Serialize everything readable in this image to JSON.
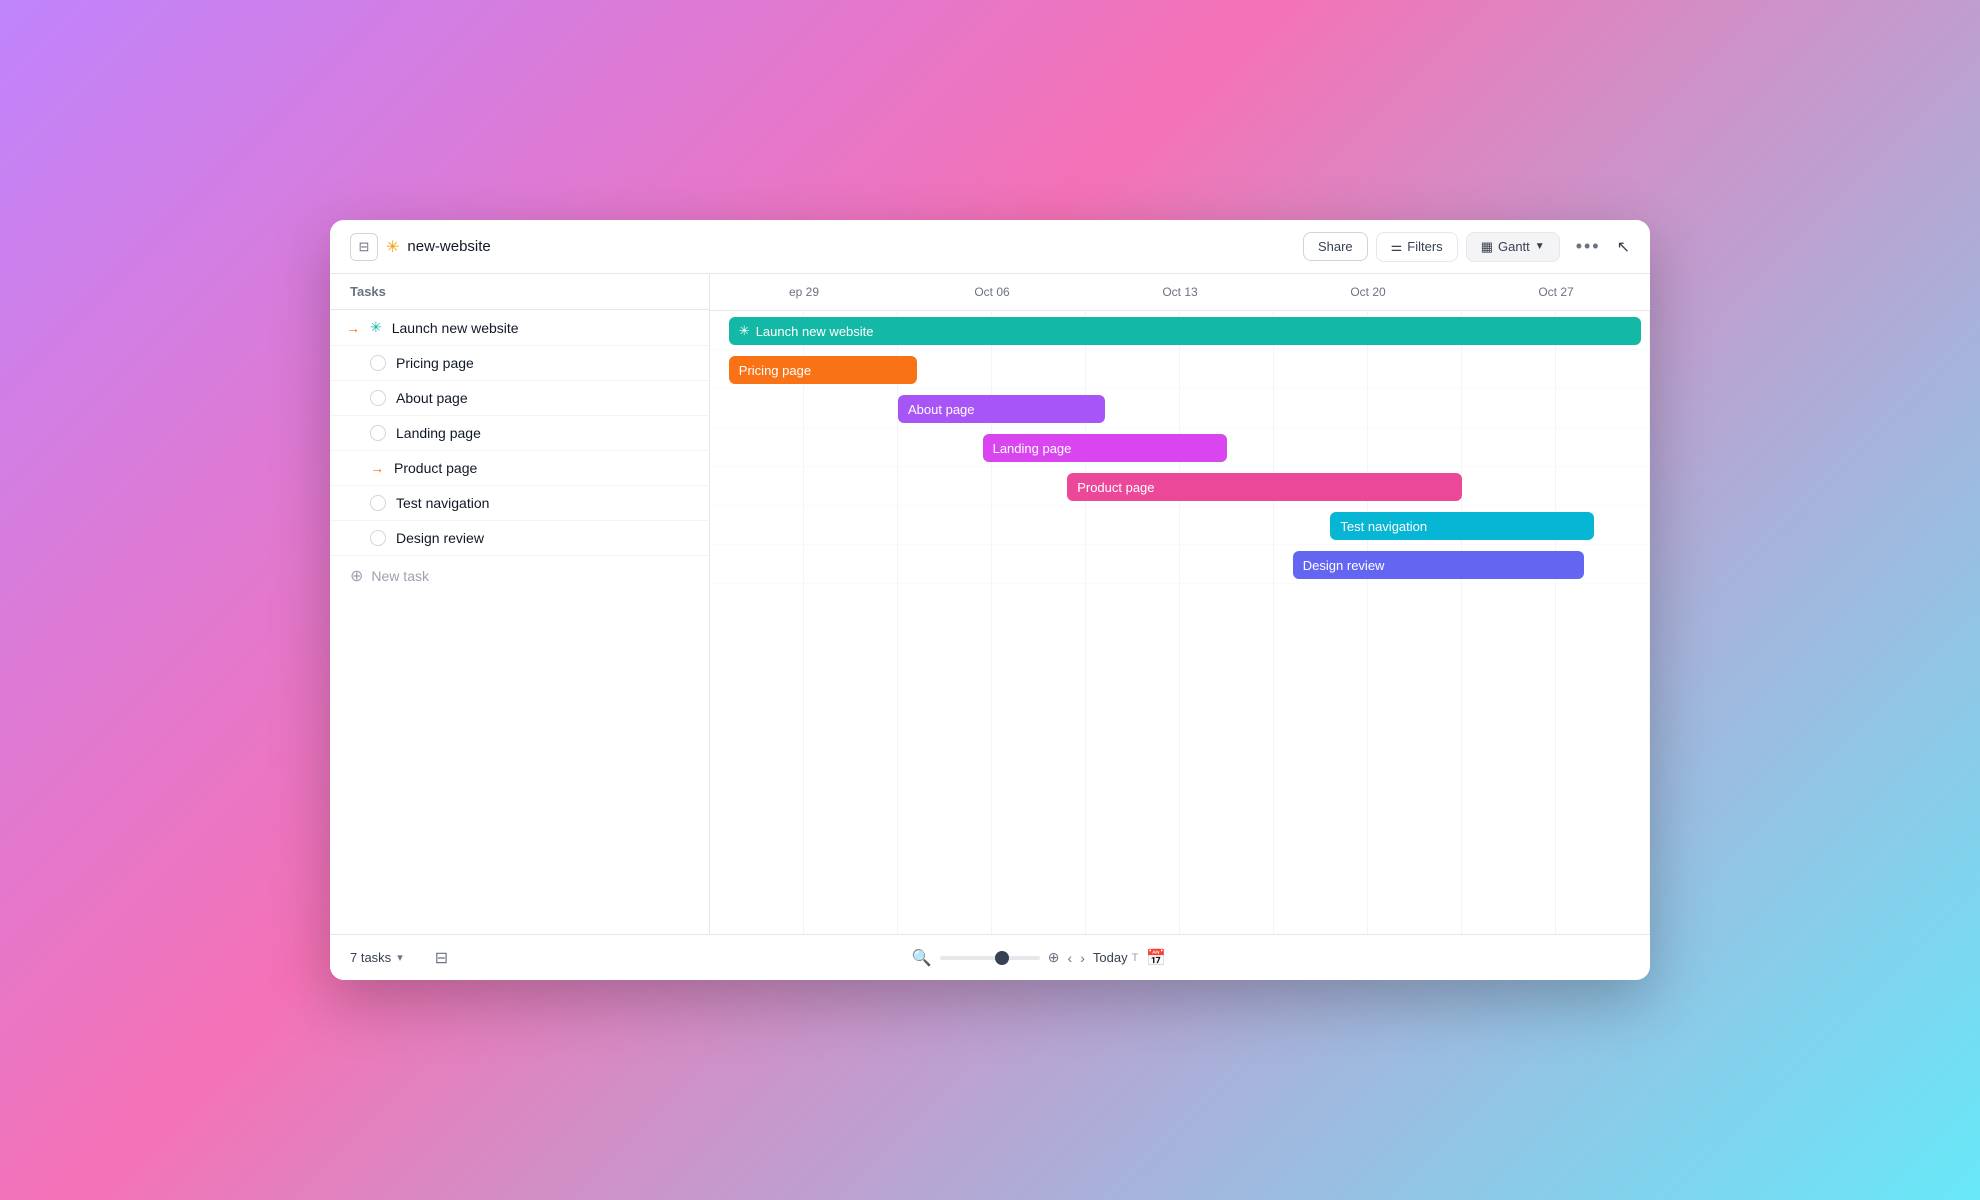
{
  "header": {
    "sidebar_icon": "⊟",
    "sun_icon": "✳",
    "project_title": "new-website",
    "share_label": "Share",
    "filters_label": "Filters",
    "gantt_label": "Gantt",
    "more_icon": "•••",
    "cursor_icon": "↖"
  },
  "task_list": {
    "header": "Tasks",
    "tasks": [
      {
        "id": "launch",
        "label": "Launch new website",
        "type": "parent",
        "icon": "sun"
      },
      {
        "id": "pricing",
        "label": "Pricing page",
        "type": "child",
        "icon": "checkbox"
      },
      {
        "id": "about",
        "label": "About page",
        "type": "child",
        "icon": "checkbox"
      },
      {
        "id": "landing",
        "label": "Landing page",
        "type": "child",
        "icon": "checkbox"
      },
      {
        "id": "product",
        "label": "Product page",
        "type": "child",
        "icon": "arrow"
      },
      {
        "id": "test",
        "label": "Test navigation",
        "type": "child",
        "icon": "checkbox"
      },
      {
        "id": "design",
        "label": "Design review",
        "type": "child",
        "icon": "checkbox"
      }
    ],
    "new_task_label": "New task"
  },
  "gantt": {
    "dates": [
      "ep 29",
      "Oct 06",
      "Oct 13",
      "Oct 20",
      "Oct 27"
    ],
    "bars": [
      {
        "id": "launch",
        "label": "Launch new website",
        "color": "#14b8a6",
        "left_pct": 0,
        "width_pct": 100,
        "icon": "✳"
      },
      {
        "id": "pricing",
        "label": "Pricing page",
        "color": "#f97316",
        "left_pct": 0,
        "width_pct": 22
      },
      {
        "id": "about",
        "label": "About page",
        "color": "#a855f7",
        "left_pct": 19,
        "width_pct": 22
      },
      {
        "id": "landing",
        "label": "Landing page",
        "color": "#d946ef",
        "left_pct": 29,
        "width_pct": 25
      },
      {
        "id": "product",
        "label": "Product page",
        "color": "#ec4899",
        "left_pct": 38,
        "width_pct": 38
      },
      {
        "id": "test",
        "label": "Test navigation",
        "color": "#06b6d4",
        "left_pct": 65,
        "width_pct": 27
      },
      {
        "id": "design",
        "label": "Design review",
        "color": "#6366f1",
        "left_pct": 60,
        "width_pct": 30
      }
    ]
  },
  "footer": {
    "task_count": "7 tasks",
    "today_label": "Today",
    "today_shortcut": "T"
  }
}
